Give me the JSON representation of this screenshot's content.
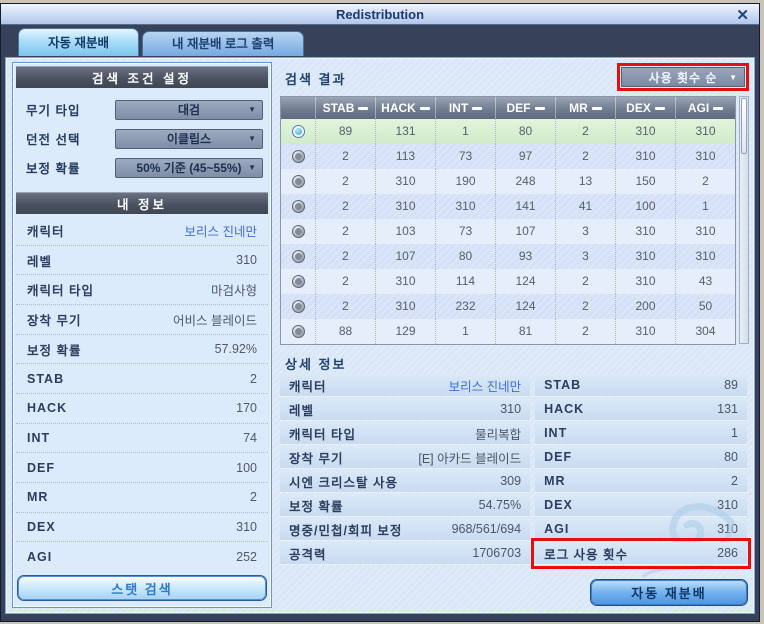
{
  "window": {
    "title": "Redistribution",
    "close_icon": "✕"
  },
  "icons": {
    "chevron_down": "▼"
  },
  "colors": {
    "annotation_red": "#e60f0f",
    "selected_row_green": "#d9efd4",
    "accent_blue": "#3e6ed6",
    "header_slate": "#4a515f"
  },
  "tabs": [
    {
      "label": "자동 재분배",
      "active": true
    },
    {
      "label": "내 재분배 로그 출력",
      "active": false
    }
  ],
  "search_conditions": {
    "header": "검색 조건 설정",
    "fields": [
      {
        "label": "무기 타입",
        "value": "대검"
      },
      {
        "label": "던전 선택",
        "value": "이클립스"
      },
      {
        "label": "보정 확률",
        "value": "50% 기준 (45~55%)"
      }
    ]
  },
  "my_info": {
    "header": "내 정보",
    "rows": [
      {
        "label": "캐릭터",
        "value": "보리스 진네만"
      },
      {
        "label": "레벨",
        "value": "310"
      },
      {
        "label": "캐릭터 타입",
        "value": "마검사형"
      },
      {
        "label": "장착 무기",
        "value": "어비스 블레이드"
      },
      {
        "label": "보정 확률",
        "value": "57.92%"
      },
      {
        "label": "STAB",
        "value": "2"
      },
      {
        "label": "HACK",
        "value": "170"
      },
      {
        "label": "INT",
        "value": "74"
      },
      {
        "label": "DEF",
        "value": "100"
      },
      {
        "label": "MR",
        "value": "2"
      },
      {
        "label": "DEX",
        "value": "310"
      },
      {
        "label": "AGI",
        "value": "252"
      }
    ]
  },
  "buttons": {
    "stat_search": "스탯 검색",
    "auto_redistribute": "자동 재분배"
  },
  "results": {
    "title": "검색 결과",
    "sort_label": "사용 횟수 순",
    "columns": [
      "STAB",
      "HACK",
      "INT",
      "DEF",
      "MR",
      "DEX",
      "AGI"
    ],
    "rows": [
      {
        "selected": true,
        "values": [
          "89",
          "131",
          "1",
          "80",
          "2",
          "310",
          "310"
        ]
      },
      {
        "selected": false,
        "values": [
          "2",
          "113",
          "73",
          "97",
          "2",
          "310",
          "310"
        ]
      },
      {
        "selected": false,
        "values": [
          "2",
          "310",
          "190",
          "248",
          "13",
          "150",
          "2"
        ]
      },
      {
        "selected": false,
        "values": [
          "2",
          "310",
          "310",
          "141",
          "41",
          "100",
          "1"
        ]
      },
      {
        "selected": false,
        "values": [
          "2",
          "103",
          "73",
          "107",
          "3",
          "310",
          "310"
        ]
      },
      {
        "selected": false,
        "values": [
          "2",
          "107",
          "80",
          "93",
          "3",
          "310",
          "310"
        ]
      },
      {
        "selected": false,
        "values": [
          "2",
          "310",
          "114",
          "124",
          "2",
          "310",
          "43"
        ]
      },
      {
        "selected": false,
        "values": [
          "2",
          "310",
          "232",
          "124",
          "2",
          "200",
          "50"
        ]
      },
      {
        "selected": false,
        "values": [
          "88",
          "129",
          "1",
          "81",
          "2",
          "310",
          "304"
        ]
      }
    ]
  },
  "details": {
    "title": "상세 정보",
    "left": [
      {
        "label": "캐릭터",
        "value": "보리스 진네만"
      },
      {
        "label": "레벨",
        "value": "310"
      },
      {
        "label": "캐릭터 타입",
        "value": "물리복합"
      },
      {
        "label": "장착 무기",
        "value": "[E] 아카드 블레이드"
      },
      {
        "label": "시엔 크리스탈 사용",
        "value": "309"
      },
      {
        "label": "보정 확률",
        "value": "54.75%"
      },
      {
        "label": "명중/민첩/회피 보정",
        "value": "968/561/694"
      },
      {
        "label": "공격력",
        "value": "1706703"
      }
    ],
    "right": [
      {
        "label": "STAB",
        "value": "89"
      },
      {
        "label": "HACK",
        "value": "131"
      },
      {
        "label": "INT",
        "value": "1"
      },
      {
        "label": "DEF",
        "value": "80"
      },
      {
        "label": "MR",
        "value": "2"
      },
      {
        "label": "DEX",
        "value": "310"
      },
      {
        "label": "AGI",
        "value": "310"
      },
      {
        "label": "로그 사용 횟수",
        "value": "286",
        "annotated": true
      }
    ]
  }
}
